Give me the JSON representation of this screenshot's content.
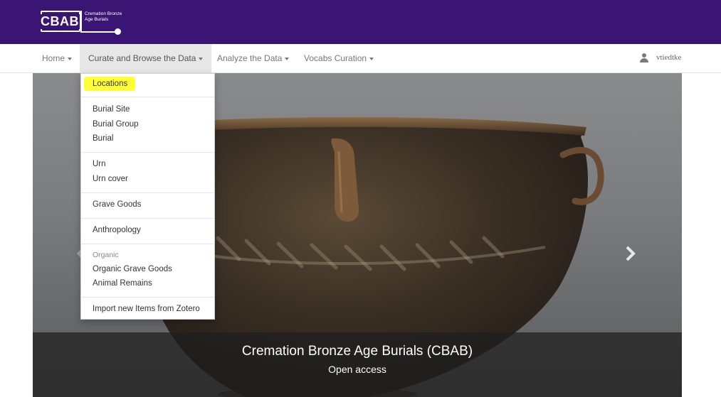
{
  "header": {
    "logo_abbr": "CBAB",
    "logo_full": "Cremation Bronze Age Burials",
    "bg_color": "#3a1574"
  },
  "nav": {
    "items": [
      {
        "label": "Home"
      },
      {
        "label": "Curate and Browse the Data"
      },
      {
        "label": "Analyze the Data"
      },
      {
        "label": "Vocabs Curation"
      }
    ],
    "user": {
      "name": "vtiedtke",
      "icon": "user-icon"
    }
  },
  "dropdown": {
    "locations": "Locations",
    "burial_site": "Burial Site",
    "burial_group": "Burial Group",
    "burial": "Burial",
    "urn": "Urn",
    "urn_cover": "Urn cover",
    "grave_goods": "Grave Goods",
    "anthropology": "Anthropology",
    "organic_header": "Organic",
    "organic_grave_goods": "Organic Grave Goods",
    "animal_remains": "Animal Remains",
    "import_zotero": "Import new Items from Zotero",
    "highlight_color": "#ffff33"
  },
  "carousel": {
    "title": "Cremation Bronze Age Burials (CBAB)",
    "subtitle": "Open access"
  }
}
